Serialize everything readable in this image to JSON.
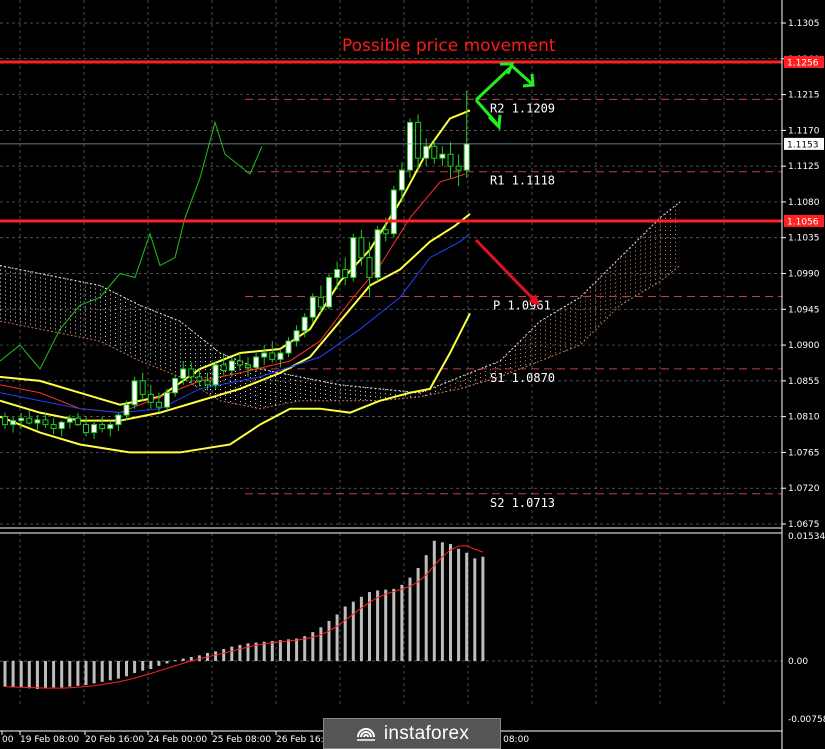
{
  "chart_data": {
    "type": "candlestick",
    "title": "Possible price movement",
    "price_axis": {
      "min": 1.065,
      "max": 1.1335,
      "ticks": [
        1.1305,
        1.126,
        1.1215,
        1.117,
        1.1125,
        1.108,
        1.1035,
        1.099,
        1.0945,
        1.09,
        1.0855,
        1.081,
        1.0765,
        1.072,
        1.0675
      ],
      "tick_labels": [
        "1.1305",
        "1.1260",
        "1.1215",
        "1.1170",
        "1.1125",
        "1.1080",
        "1.1035",
        "1.0990",
        "1.0945",
        "1.0900",
        "1.0855",
        "1.0810",
        "1.0765",
        "1.0720",
        "1.0675"
      ],
      "current_price_label": "1.1153",
      "level_labels": [
        "1.1256",
        "1.1056"
      ]
    },
    "time_axis": {
      "labels": [
        "00",
        "19 Feb 08:00",
        "20 Feb 16:00",
        "24 Feb 00:00",
        "25 Feb 08:00",
        "26 Feb 16:00",
        "28 Feb 08:00"
      ]
    },
    "horizontal_levels": [
      {
        "label": "1.1256",
        "value": 1.1256,
        "color": "#ff2020",
        "style": "solid"
      },
      {
        "label": "1.1056",
        "value": 1.1056,
        "color": "#ff2020",
        "style": "solid"
      }
    ],
    "pivot_levels": [
      {
        "name": "R2",
        "value": 1.1209,
        "value_label": "1.1209"
      },
      {
        "name": "R1",
        "value": 1.1118,
        "value_label": "1.1118"
      },
      {
        "name": "P",
        "value": 1.0961,
        "value_label": "1.0961"
      },
      {
        "name": "S1",
        "value": 1.087,
        "value_label": "1.0870"
      },
      {
        "name": "S2",
        "value": 1.0713,
        "value_label": "1.0713"
      }
    ],
    "candles": [
      [
        1.081,
        1.0815,
        1.0795,
        1.08
      ],
      [
        1.08,
        1.081,
        1.079,
        1.0805
      ],
      [
        1.0805,
        1.0815,
        1.0795,
        1.0808
      ],
      [
        1.0808,
        1.0818,
        1.08,
        1.0802
      ],
      [
        1.0802,
        1.0812,
        1.0792,
        1.0806
      ],
      [
        1.0806,
        1.0814,
        1.0796,
        1.08
      ],
      [
        1.08,
        1.0808,
        1.0788,
        1.0795
      ],
      [
        1.0795,
        1.0805,
        1.0785,
        1.0803
      ],
      [
        1.0803,
        1.0812,
        1.0795,
        1.0808
      ],
      [
        1.0808,
        1.0815,
        1.0798,
        1.08
      ],
      [
        1.08,
        1.081,
        1.0785,
        1.079
      ],
      [
        1.079,
        1.0805,
        1.0782,
        1.08
      ],
      [
        1.08,
        1.081,
        1.079,
        1.0795
      ],
      [
        1.0795,
        1.0805,
        1.0785,
        1.08
      ],
      [
        1.08,
        1.0815,
        1.0792,
        1.0812
      ],
      [
        1.0812,
        1.083,
        1.0805,
        1.0825
      ],
      [
        1.0825,
        1.086,
        1.082,
        1.0855
      ],
      [
        1.0855,
        1.0865,
        1.083,
        1.0838
      ],
      [
        1.0838,
        1.085,
        1.082,
        1.0828
      ],
      [
        1.0828,
        1.084,
        1.0815,
        1.0822
      ],
      [
        1.0822,
        1.0845,
        1.0818,
        1.084
      ],
      [
        1.084,
        1.0862,
        1.0835,
        1.0858
      ],
      [
        1.0858,
        1.088,
        1.085,
        1.087
      ],
      [
        1.087,
        1.0878,
        1.0852,
        1.086
      ],
      [
        1.086,
        1.087,
        1.0848,
        1.0855
      ],
      [
        1.0855,
        1.0865,
        1.0843,
        1.085
      ],
      [
        1.085,
        1.088,
        1.0845,
        1.0875
      ],
      [
        1.0875,
        1.089,
        1.0862,
        1.0868
      ],
      [
        1.0868,
        1.0885,
        1.086,
        1.088
      ],
      [
        1.088,
        1.089,
        1.0868,
        1.0875
      ],
      [
        1.0875,
        1.0885,
        1.086,
        1.0872
      ],
      [
        1.0872,
        1.089,
        1.0866,
        1.0885
      ],
      [
        1.0885,
        1.09,
        1.0875,
        1.089
      ],
      [
        1.089,
        1.0905,
        1.0878,
        1.0882
      ],
      [
        1.0882,
        1.0895,
        1.0872,
        1.089
      ],
      [
        1.089,
        1.091,
        1.0885,
        1.0905
      ],
      [
        1.0905,
        1.0925,
        1.0898,
        1.0918
      ],
      [
        1.0918,
        1.094,
        1.091,
        1.0935
      ],
      [
        1.0935,
        1.0965,
        1.0928,
        1.096
      ],
      [
        1.096,
        1.0975,
        1.094,
        1.0948
      ],
      [
        1.0948,
        1.099,
        1.0945,
        1.0985
      ],
      [
        1.0985,
        1.1005,
        1.097,
        1.0995
      ],
      [
        1.0995,
        1.101,
        1.0975,
        1.0985
      ],
      [
        1.0985,
        1.104,
        1.098,
        1.1035
      ],
      [
        1.1035,
        1.1045,
        1.1,
        1.101
      ],
      [
        1.101,
        1.103,
        1.096,
        1.0985
      ],
      [
        1.0985,
        1.105,
        1.098,
        1.1045
      ],
      [
        1.1045,
        1.106,
        1.103,
        1.104
      ],
      [
        1.104,
        1.11,
        1.1035,
        1.1095
      ],
      [
        1.1095,
        1.113,
        1.108,
        1.112
      ],
      [
        1.112,
        1.1185,
        1.111,
        1.118
      ],
      [
        1.118,
        1.119,
        1.112,
        1.1135
      ],
      [
        1.1135,
        1.116,
        1.1125,
        1.115
      ],
      [
        1.115,
        1.1158,
        1.1128,
        1.1135
      ],
      [
        1.1135,
        1.115,
        1.1125,
        1.114
      ],
      [
        1.114,
        1.1155,
        1.111,
        1.1125
      ],
      [
        1.1125,
        1.114,
        1.11,
        1.112
      ],
      [
        1.112,
        1.122,
        1.111,
        1.1153
      ]
    ],
    "oscillator": {
      "axis_labels": [
        "0.01534",
        "0.00",
        "-0.00758"
      ],
      "min": -0.008,
      "max": 0.016,
      "bars": [
        -0.0032,
        -0.0033,
        -0.0033,
        -0.0034,
        -0.0035,
        -0.0034,
        -0.0033,
        -0.0033,
        -0.0032,
        -0.0031,
        -0.003,
        -0.0028,
        -0.0026,
        -0.0024,
        -0.0022,
        -0.0019,
        -0.0015,
        -0.0012,
        -0.001,
        -0.0006,
        -0.0003,
        0.0001,
        0.0003,
        0.0005,
        0.0007,
        0.001,
        0.0012,
        0.0015,
        0.0018,
        0.002,
        0.0022,
        0.0023,
        0.0024,
        0.0025,
        0.0026,
        0.0027,
        0.0028,
        0.0031,
        0.0036,
        0.0042,
        0.005,
        0.0058,
        0.0068,
        0.0074,
        0.008,
        0.0086,
        0.0088,
        0.0089,
        0.009,
        0.0095,
        0.0104,
        0.0116,
        0.0132,
        0.015,
        0.0148,
        0.0146,
        0.014,
        0.0135,
        0.0128,
        0.013
      ]
    }
  }
}
